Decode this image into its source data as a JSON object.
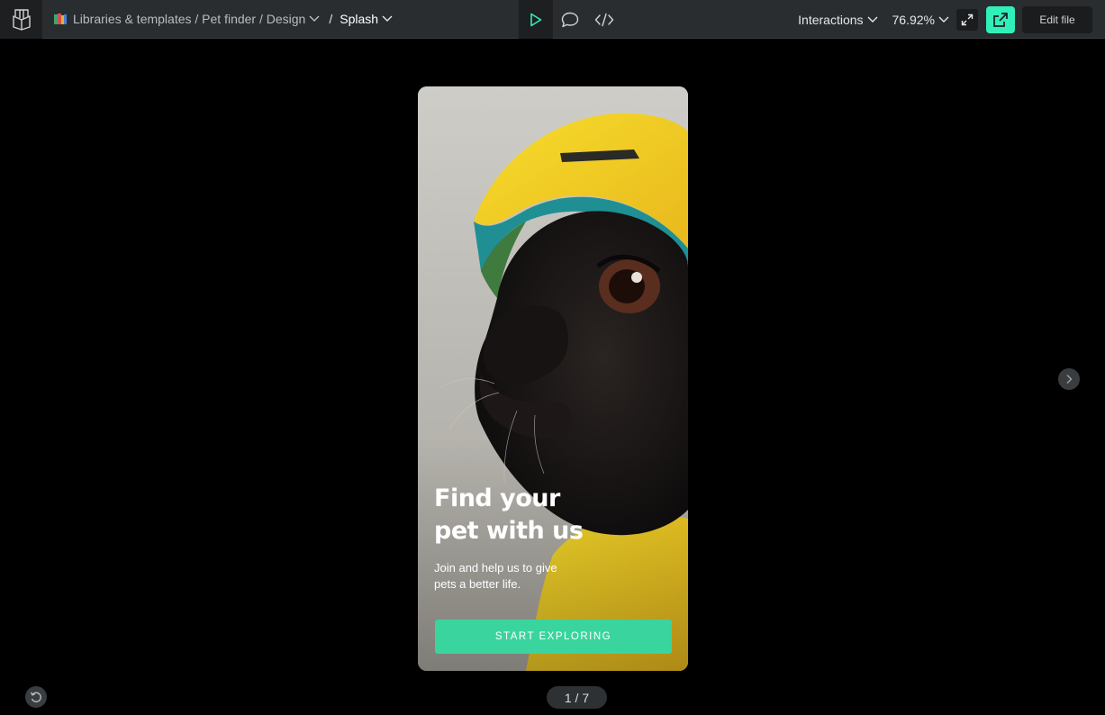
{
  "toolbar": {
    "breadcrumb": {
      "project": "Libraries & templates / Pet finder / Design",
      "separator": "/",
      "current": "Splash"
    },
    "interactions_label": "Interactions",
    "zoom_label": "76.92%",
    "edit_label": "Edit file"
  },
  "icons": {
    "logo": "penpot-logo-icon",
    "play": "play-icon",
    "comments": "comment-icon",
    "code": "code-icon",
    "fullscreen": "expand-icon",
    "share": "share-icon",
    "next": "chevron-right-icon",
    "restart": "restart-icon"
  },
  "colors": {
    "accent": "#31efb8",
    "cta": "#3ad49f",
    "toolbar_bg": "#2a2d30"
  },
  "screen": {
    "headline_line1": "Find your",
    "headline_line2": "pet with us",
    "subtitle_line1": "Join and help us to give",
    "subtitle_line2": "pets a better life.",
    "cta_label": "START EXPLORING"
  },
  "pagination": {
    "label": "1 / 7"
  }
}
